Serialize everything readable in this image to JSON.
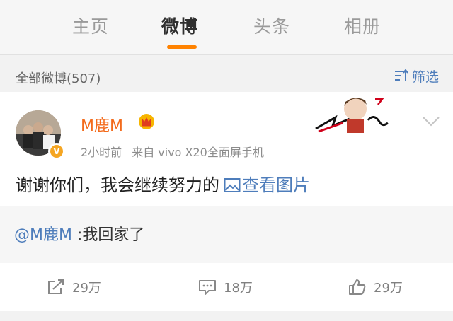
{
  "tabs": [
    {
      "label": "主页",
      "active": false
    },
    {
      "label": "微博",
      "active": true
    },
    {
      "label": "头条",
      "active": false
    },
    {
      "label": "相册",
      "active": false
    }
  ],
  "count_bar": {
    "label": "全部微博(507)",
    "filter_label": "筛选"
  },
  "post": {
    "username": "M鹿M",
    "time": "2小时前",
    "source": "来自 vivo X20全面屏手机",
    "text": "谢谢你们，我会继续努力的",
    "view_image_label": "查看图片",
    "repost": {
      "mention": "@M鹿M",
      "text": " :我回家了"
    }
  },
  "actions": {
    "repost_count": "29万",
    "comment_count": "18万",
    "like_count": "29万"
  },
  "colors": {
    "accent_orange": "#ff8200",
    "username_orange": "#f36b1c",
    "link_blue": "#4e7dbb"
  }
}
